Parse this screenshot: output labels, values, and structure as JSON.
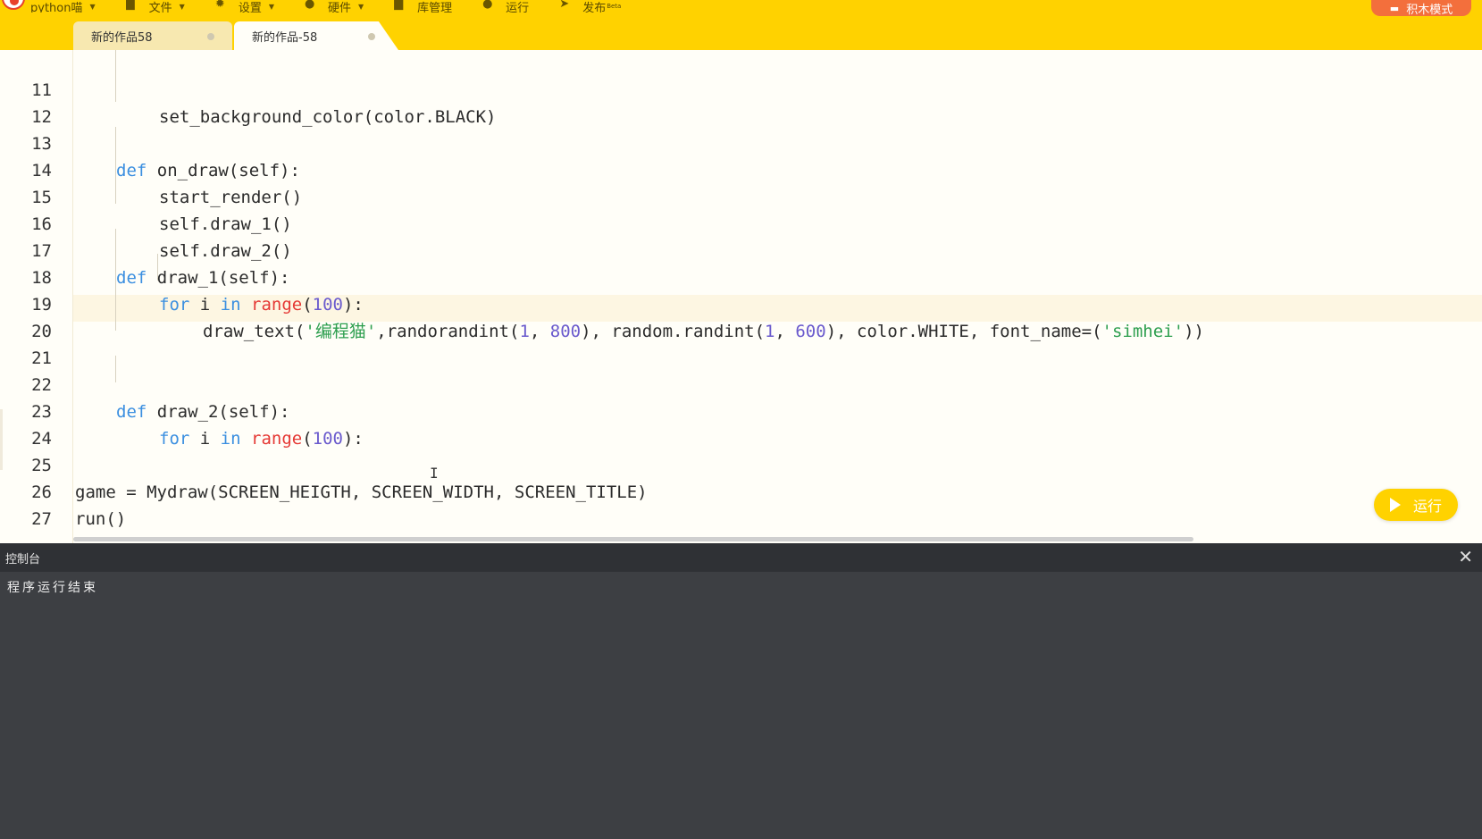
{
  "app": {
    "logo_label": "python喵",
    "menu": [
      {
        "label": "文件",
        "icon": "folder-icon"
      },
      {
        "label": "设置",
        "icon": "gear-icon"
      },
      {
        "label": "硬件",
        "icon": "hardware-icon"
      },
      {
        "label": "库管理",
        "icon": "library-icon"
      },
      {
        "label": "运行",
        "icon": "play-icon"
      },
      {
        "label": "发布",
        "icon": "publish-icon",
        "badge": "Beta"
      }
    ],
    "blocks_mode_label": "积木模式"
  },
  "tabs": [
    {
      "label": "新的作品58",
      "active": false
    },
    {
      "label": "新的作品-58",
      "active": true
    }
  ],
  "editor": {
    "lines": [
      {
        "n": "11",
        "indent": 2
      },
      {
        "n": "12",
        "indent": 0
      },
      {
        "n": "13",
        "indent": 1
      },
      {
        "n": "14",
        "indent": 2
      },
      {
        "n": "15",
        "indent": 2
      },
      {
        "n": "16",
        "indent": 2
      },
      {
        "n": "17",
        "indent": 1
      },
      {
        "n": "18",
        "indent": 2
      },
      {
        "n": "19",
        "indent": 3
      },
      {
        "n": "20",
        "indent": 0
      },
      {
        "n": "21",
        "indent": 0
      },
      {
        "n": "22",
        "indent": 1
      },
      {
        "n": "23",
        "indent": 2
      },
      {
        "n": "24",
        "indent": 0
      },
      {
        "n": "25",
        "indent": 0
      },
      {
        "n": "26",
        "indent": 0
      },
      {
        "n": "27",
        "indent": 0
      }
    ],
    "code": {
      "l11": [
        "set_background_color(color.BLACK)"
      ],
      "l13": [
        "def",
        " on_draw(self):"
      ],
      "l14": [
        "start_render()"
      ],
      "l15": [
        "self.draw_1()"
      ],
      "l16": [
        "self.draw_2()"
      ],
      "l17": [
        "def",
        " draw_1(self):"
      ],
      "l18": [
        "for",
        " i ",
        "in",
        " ",
        "range",
        "(",
        "100",
        "):"
      ],
      "l19": [
        "draw_text(",
        "'编程猫'",
        ",randorandint(",
        "1",
        ", ",
        "800",
        "), random.randint(",
        "1",
        ", ",
        "600",
        "), color.WHITE, font_name=(",
        "'simhei'",
        "))"
      ],
      "l22": [
        "def",
        " draw_2(self):"
      ],
      "l23": [
        "for",
        " i ",
        "in",
        " ",
        "range",
        "(",
        "100",
        "):"
      ],
      "l25": [
        "game = Mydraw(SCREEN_HEIGTH, SCREEN_WIDTH, SCREEN_TITLE)"
      ],
      "l26": [
        "run()"
      ]
    },
    "run_button_label": "运行",
    "colors": {
      "keyword": "#3b8fe0",
      "builtin": "#e53935",
      "number": "#6a5acd",
      "string": "#2e9f4f"
    }
  },
  "console": {
    "title": "控制台",
    "output": "程序运行结束",
    "close_icon": "close-icon"
  }
}
